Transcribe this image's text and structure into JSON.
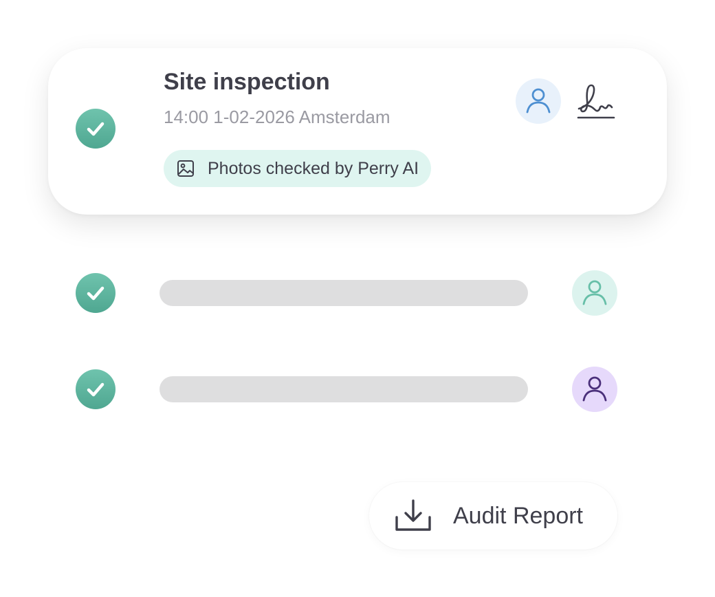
{
  "card": {
    "title": "Site inspection",
    "meta": "14:00 1-02-2026 Amsterdam",
    "badge_label": "Photos checked by Perry AI",
    "badge_icon": "image-icon",
    "avatar_icon": "user-icon",
    "signature_icon": "signature-icon"
  },
  "rows": [
    {
      "status_icon": "check-icon",
      "avatar_icon": "user-icon",
      "avatar_color": "#dcf3ee",
      "avatar_stroke": "#67bfa8"
    },
    {
      "status_icon": "check-icon",
      "avatar_icon": "user-icon",
      "avatar_color": "#e6d9fb",
      "avatar_stroke": "#4a2f7a"
    }
  ],
  "audit_button": {
    "label": "Audit Report",
    "icon": "download-icon"
  },
  "colors": {
    "check": "#5bb39d",
    "badge_bg": "#dff5f0",
    "card_avatar_bg": "#e8f1fb",
    "card_avatar_stroke": "#4d8fd1",
    "placeholder": "#dededf",
    "text": "#3f3f4a",
    "muted": "#9a9aa2"
  }
}
